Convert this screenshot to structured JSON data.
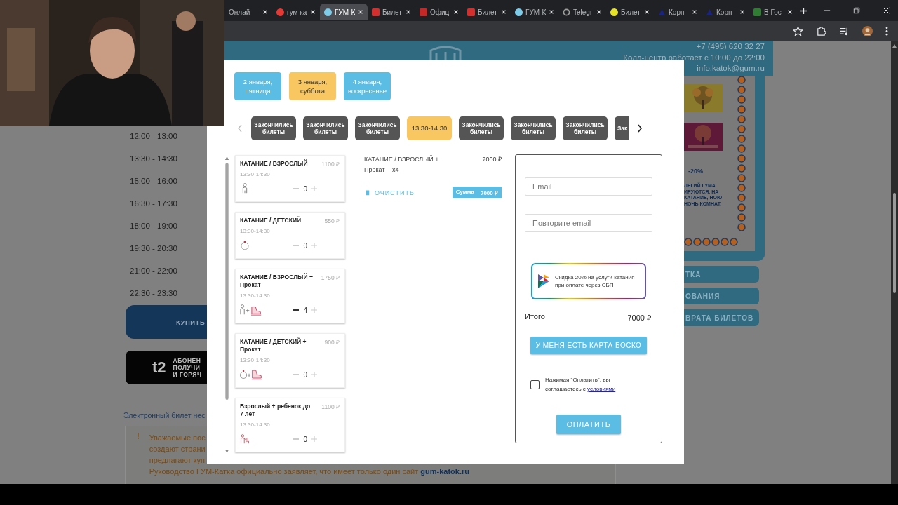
{
  "browser": {
    "tabs": [
      {
        "label": "Онлай",
        "selected": false
      },
      {
        "label": "гум ка",
        "selected": false
      },
      {
        "label": "ГУМ-К",
        "selected": true
      },
      {
        "label": "Билет",
        "selected": false
      },
      {
        "label": "Офиц",
        "selected": false
      },
      {
        "label": "Билет",
        "selected": false
      },
      {
        "label": "ГУМ-К",
        "selected": false
      },
      {
        "label": "Telegr",
        "selected": false
      },
      {
        "label": "Билет",
        "selected": false
      },
      {
        "label": "Корп",
        "selected": false
      },
      {
        "label": "Корп",
        "selected": false
      },
      {
        "label": "В Гос",
        "selected": false
      }
    ]
  },
  "site_header": {
    "phone": "+7 (495) 620 32 27",
    "hours": "Колл-центр работает с 10:00 до 22:00",
    "email": "info.katok@gum.ru"
  },
  "schedule": {
    "times": [
      "12:00 - 13:00",
      "13:30 - 14:30",
      "15:00 - 16:00",
      "16:30 - 17:30",
      "18:00 - 19:00",
      "19:30 - 20:30",
      "21:00 - 22:00",
      "22:30 - 23:30"
    ],
    "buy_button": "КУПИТЬ",
    "t2_banner": {
      "logo": "t2",
      "lines": [
        "АБОНЕН",
        "ПОЛУЧИ",
        "И ГОРЯЧ"
      ]
    },
    "e_ticket_link": "Электронный билет нес",
    "notice": {
      "mark": "!",
      "lines": [
        "Уважаемые пос",
        "создают страни",
        "предлагают куп"
      ],
      "last_line": "Руководство ГУМ-Катка официально заявляет, что имеет только один сайт",
      "site_link": "gum-katok.ru"
    }
  },
  "side_panel": {
    "discount": "-20%",
    "note": "ЛЕГИЙ ГУМА ИРУЮТСЯ. НА КАТАНИЕ, НОЮ НОЧЬ КОМНАТ.",
    "buttons": [
      "ТКА",
      "ОВАНИЯ",
      "ВРАТА БИЛЕТОВ"
    ]
  },
  "modal": {
    "dates": [
      {
        "label": "2 января, пятница",
        "selected": false
      },
      {
        "label": "3 января, суббота",
        "selected": true
      },
      {
        "label": "4 января, воскресенье",
        "selected": false
      }
    ],
    "slots": [
      {
        "label": "Закончились билеты",
        "sold_out": true,
        "selected": false
      },
      {
        "label": "Закончились билеты",
        "sold_out": true,
        "selected": false
      },
      {
        "label": "Закончились билеты",
        "sold_out": true,
        "selected": false
      },
      {
        "label": "13.30-14.30",
        "sold_out": false,
        "selected": true
      },
      {
        "label": "Закончились билеты",
        "sold_out": true,
        "selected": false
      },
      {
        "label": "Закончились билеты",
        "sold_out": true,
        "selected": false
      },
      {
        "label": "Закончились билеты",
        "sold_out": true,
        "selected": false
      },
      {
        "label": "Зак",
        "sold_out": true,
        "selected": false
      }
    ],
    "tickets": [
      {
        "title": "КАТАНИЕ / ВЗРОСЛЫЙ",
        "price": "1100 ₽",
        "time": "13:30-14:30",
        "kind": "adult",
        "count": "0"
      },
      {
        "title": "КАТАНИЕ / ДЕТСКИЙ",
        "price": "550 ₽",
        "time": "13:30-14:30",
        "kind": "child",
        "count": "0"
      },
      {
        "title": "КАТАНИЕ / ВЗРОСЛЫЙ + Прокат",
        "price": "1750 ₽",
        "time": "13:30-14:30",
        "kind": "adult-rental",
        "count": "4"
      },
      {
        "title": "КАТАНИЕ / ДЕТСКИЙ + Прокат",
        "price": "900 ₽",
        "time": "13:30-14:30",
        "kind": "child-rental",
        "count": "0"
      },
      {
        "title": "Взрослый + ребенок до 7 лет",
        "price": "1100 ₽",
        "time": "13:30-14:30",
        "kind": "adult-child",
        "count": "0"
      }
    ],
    "cart": {
      "item": "КАТАНИЕ / ВЗРОСЛЫЙ + Прокат",
      "qty": "x4",
      "price": "7000 ₽",
      "clear": "ОЧИСТИТЬ",
      "sum_label": "Сумма",
      "sum_value": "7000 ₽"
    },
    "form": {
      "email_placeholder": "Email",
      "repeat_placeholder": "Повторите email",
      "promo": "Скидка 20% на услуги катания при оплате через СБП",
      "total_label": "Итого",
      "total_value": "7000 ₽",
      "card_button": "У МЕНЯ ЕСТЬ КАРТА БОСКО",
      "consent": {
        "checked": false,
        "text": "Нажимая \"Оплатить\", вы соглашаетесь с",
        "link": "условиями"
      },
      "pay_button": "ОПЛАТИТЬ"
    }
  }
}
